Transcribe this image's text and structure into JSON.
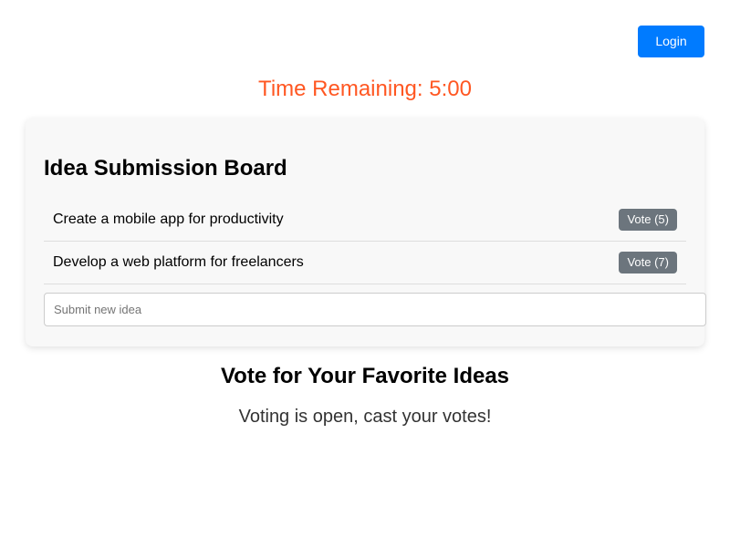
{
  "header": {
    "login_label": "Login"
  },
  "timer": {
    "text": "Time Remaining: 5:00"
  },
  "board": {
    "title": "Idea Submission Board",
    "ideas": [
      {
        "text": "Create a mobile app for productivity",
        "vote_label": "Vote (5)",
        "votes": 5
      },
      {
        "text": "Develop a web platform for freelancers",
        "vote_label": "Vote (7)",
        "votes": 7
      }
    ],
    "new_idea": {
      "value": "",
      "placeholder": "Submit new idea"
    }
  },
  "voting": {
    "title": "Vote for Your Favorite Ideas",
    "status": "Voting is open, cast your votes!"
  },
  "colors": {
    "primary": "#007bff",
    "timer": "#ff5722",
    "vote_button": "#6c757d",
    "board_background": "#f8f8f8"
  }
}
